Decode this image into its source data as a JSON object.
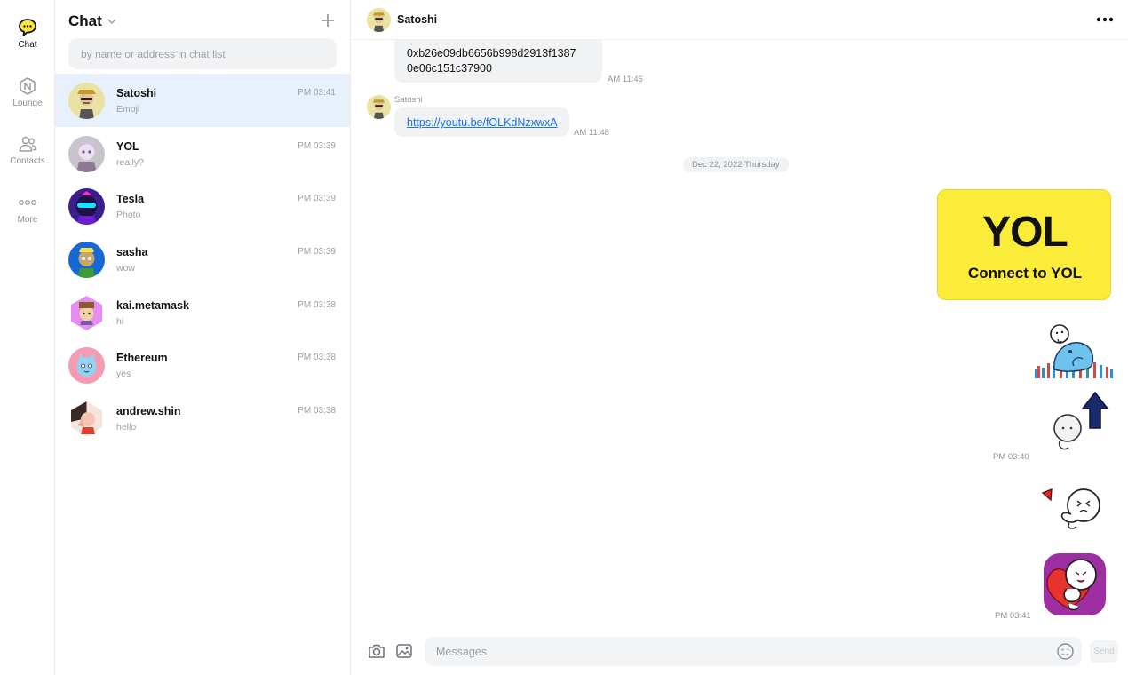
{
  "rail": {
    "items": [
      {
        "label": "Chat",
        "icon": "chat-bubble-icon",
        "active": true
      },
      {
        "label": "Lounge",
        "icon": "n-badge-icon",
        "active": false
      },
      {
        "label": "Contacts",
        "icon": "people-icon",
        "active": false
      },
      {
        "label": "More",
        "icon": "dots-icon",
        "active": false
      }
    ]
  },
  "chat_list": {
    "title": "Chat",
    "search_placeholder": "by name or address in chat list",
    "rows": [
      {
        "name": "Satoshi",
        "preview": "Emoji",
        "time": "PM 03:41",
        "active": true
      },
      {
        "name": "YOL",
        "preview": "really?",
        "time": "PM 03:39",
        "active": false
      },
      {
        "name": "Tesla",
        "preview": "Photo",
        "time": "PM 03:39",
        "active": false
      },
      {
        "name": "sasha",
        "preview": "wow",
        "time": "PM 03:39",
        "active": false
      },
      {
        "name": "kai.metamask",
        "preview": "hi",
        "time": "PM 03:38",
        "active": false
      },
      {
        "name": "Ethereum",
        "preview": "yes",
        "time": "PM 03:38",
        "active": false
      },
      {
        "name": "andrew.shin",
        "preview": "hello",
        "time": "PM 03:38",
        "active": false
      }
    ]
  },
  "conversation": {
    "header_name": "Satoshi",
    "messages": {
      "address_line1": "0xb26e09db6656b998d2913f1387",
      "address_line2": "0e06c151c37900",
      "address_time": "AM 11:46",
      "link_sender": "Satoshi",
      "link_text": "https://youtu.be/fOLKdNzxwxA",
      "link_time": "AM 11:48",
      "date_divider": "Dec 22, 2022 Thursday",
      "card_logo": "YOL",
      "card_subtitle": "Connect to YOL",
      "sticker_time_1": "PM 03:40",
      "sticker_time_2": "PM 03:41"
    },
    "composer": {
      "placeholder": "Messages",
      "send_label": "Send"
    }
  },
  "colors": {
    "accent_yellow": "#fcec3a",
    "active_row": "#e8f1fb",
    "link": "#1a73e8"
  }
}
